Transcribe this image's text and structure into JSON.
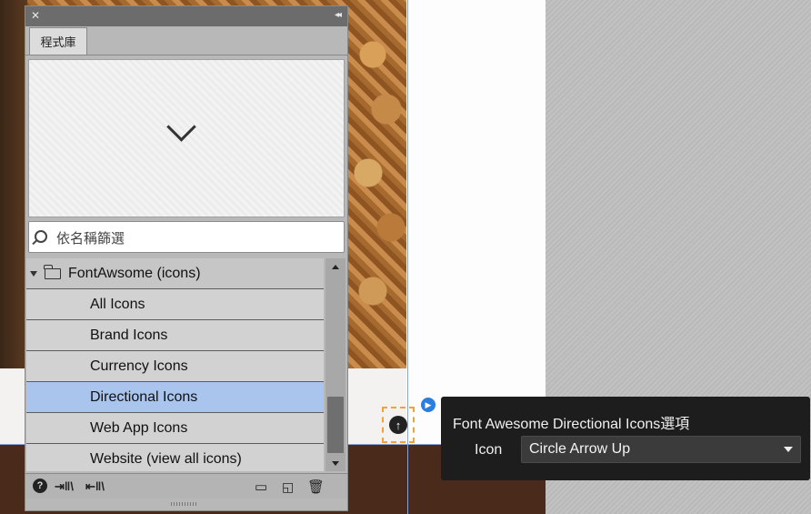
{
  "panel": {
    "tab_label": "程式庫",
    "search_placeholder": "依名稱篩選",
    "folder": {
      "label": "FontAwsome (icons)",
      "items": [
        {
          "label": "All Icons"
        },
        {
          "label": "Brand Icons"
        },
        {
          "label": "Currency Icons"
        },
        {
          "label": "Directional Icons"
        },
        {
          "label": "Web App Icons"
        },
        {
          "label": "Website (view all icons)"
        }
      ],
      "selected_index": 3
    },
    "toolbar": {
      "help_icon": "question-circle-icon",
      "import_icon": "import-library-icon",
      "export_icon": "export-library-icon",
      "new_folder_icon": "new-folder-icon",
      "new_item_icon": "new-item-icon",
      "trash_icon": "trash-icon"
    }
  },
  "popup": {
    "title": "Font Awesome Directional Icons選項",
    "icon_label": "Icon",
    "icon_value": "Circle Arrow Up"
  },
  "colors": {
    "selection": "#a9c5ee",
    "popup_bg": "#1d1d1d",
    "accent_blue": "#2b7de0",
    "selection_handle": "#f0a13a"
  }
}
